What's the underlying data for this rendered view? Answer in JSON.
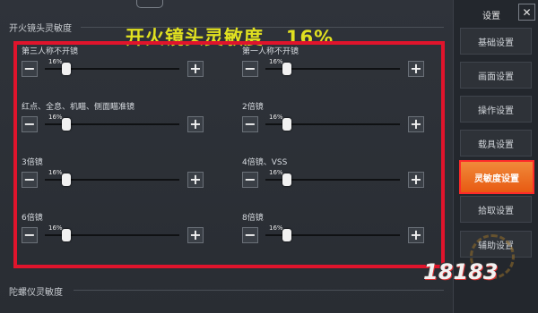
{
  "overlay_title": "开火镜头灵敏度   16%",
  "section": {
    "title": "开火镜头灵敏度",
    "next_title": "陀螺仪灵敏度"
  },
  "rows": [
    {
      "label": "第三人称不开镜",
      "value_text": "16%",
      "value": 16
    },
    {
      "label": "第一人称不开镜",
      "value_text": "16%",
      "value": 16
    },
    {
      "label": "红点、全息、机瞄、侧面瞄准镜",
      "value_text": "16%",
      "value": 16
    },
    {
      "label": "2倍镜",
      "value_text": "16%",
      "value": 16
    },
    {
      "label": "3倍镜",
      "value_text": "16%",
      "value": 16
    },
    {
      "label": "4倍镜、VSS",
      "value_text": "16%",
      "value": 16
    },
    {
      "label": "6倍镜",
      "value_text": "16%",
      "value": 16
    },
    {
      "label": "8倍镜",
      "value_text": "16%",
      "value": 16
    }
  ],
  "buttons": {
    "minus": "−",
    "plus": "+"
  },
  "sidebar": {
    "title": "设置",
    "close": "✕",
    "items": [
      "基础设置",
      "画面设置",
      "操作设置",
      "载具设置",
      "灵敏度设置",
      "拾取设置",
      "辅助设置"
    ],
    "active_index": 4
  },
  "watermark": "18183",
  "colors": {
    "highlight_frame": "#e0142c",
    "overlay_text": "#e0e020",
    "active_tab": "#e85a12"
  }
}
